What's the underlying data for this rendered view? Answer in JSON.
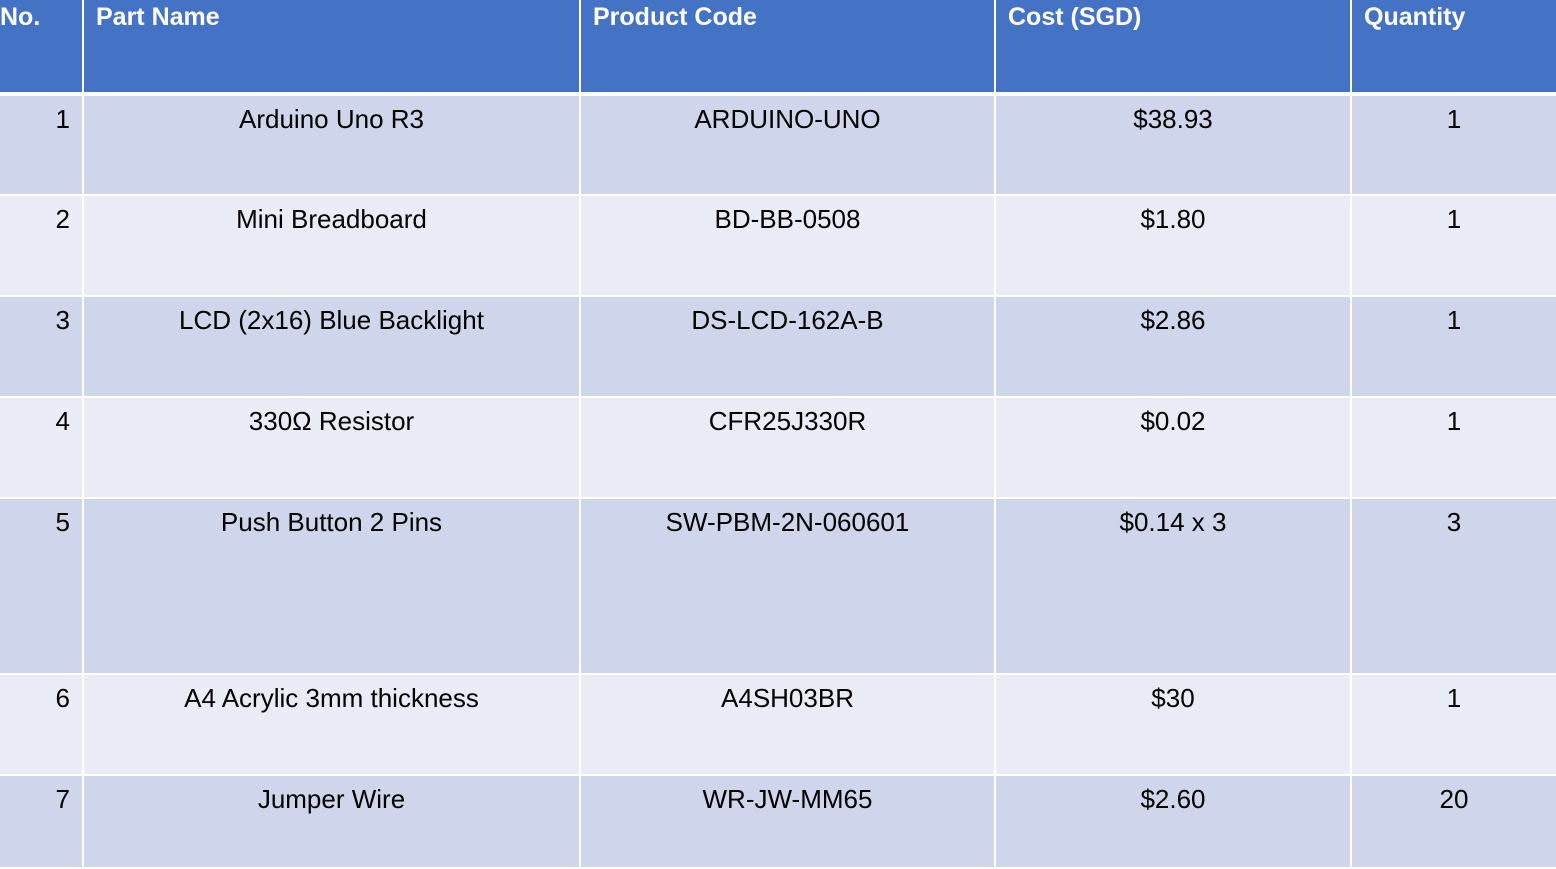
{
  "table": {
    "headers": {
      "no": "No.",
      "part_name": "Part Name",
      "product_code": "Product Code",
      "cost": "Cost (SGD)",
      "quantity": "Quantity"
    },
    "rows": [
      {
        "no": "1",
        "part_name": "Arduino Uno R3",
        "product_code": "ARDUINO-UNO",
        "cost": "$38.93",
        "quantity": "1"
      },
      {
        "no": "2",
        "part_name": "Mini Breadboard",
        "product_code": "BD-BB-0508",
        "cost": "$1.80",
        "quantity": "1"
      },
      {
        "no": "3",
        "part_name": "LCD (2x16) Blue Backlight",
        "product_code": "DS-LCD-162A-B",
        "cost": "$2.86",
        "quantity": "1"
      },
      {
        "no": "4",
        "part_name": "330Ω Resistor",
        "product_code": "CFR25J330R",
        "cost": "$0.02",
        "quantity": "1"
      },
      {
        "no": "5",
        "part_name": "Push Button 2 Pins",
        "product_code": "SW-PBM-2N-060601",
        "cost": "$0.14 x 3",
        "quantity": "3"
      },
      {
        "no": "6",
        "part_name": "A4 Acrylic 3mm thickness",
        "product_code": "A4SH03BR",
        "cost": "$30",
        "quantity": "1"
      },
      {
        "no": "7",
        "part_name": "Jumper Wire",
        "product_code": "WR-JW-MM65",
        "cost": "$2.60",
        "quantity": "20"
      }
    ]
  },
  "colors": {
    "header_bg": "#4472c4",
    "row_odd_bg": "#cfd5ea",
    "row_even_bg": "#e9ebf5"
  }
}
